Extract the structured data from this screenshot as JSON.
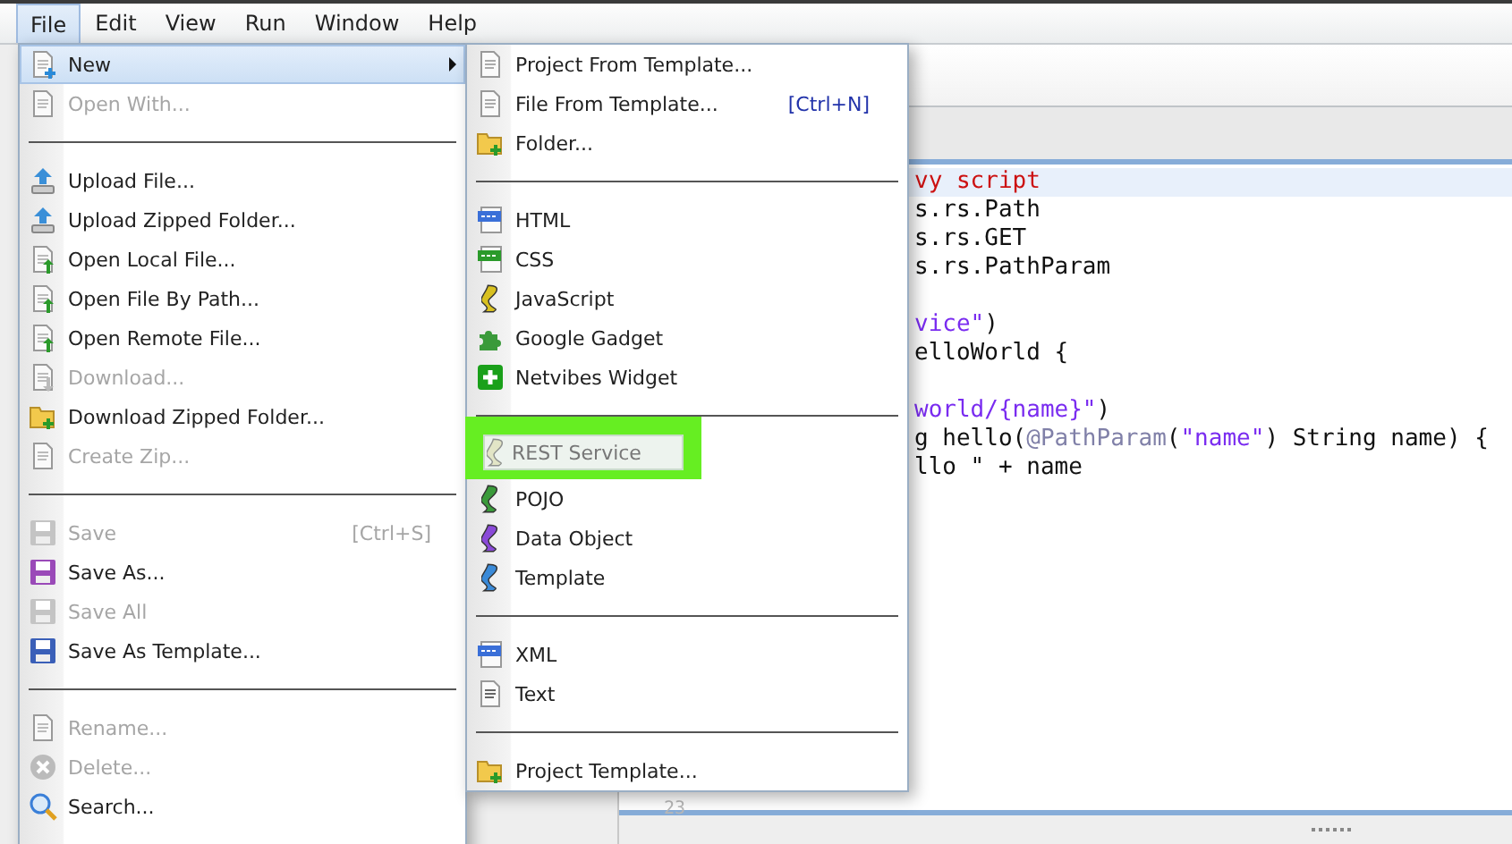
{
  "menubar": [
    {
      "label": "File",
      "selected": true
    },
    {
      "label": "Edit",
      "selected": false
    },
    {
      "label": "View",
      "selected": false
    },
    {
      "label": "Run",
      "selected": false
    },
    {
      "label": "Window",
      "selected": false
    },
    {
      "label": "Help",
      "selected": false
    }
  ],
  "file_menu": {
    "items": [
      {
        "kind": "item",
        "label": "New",
        "disabled": false,
        "selected": true,
        "submenu": true
      },
      {
        "kind": "item",
        "label": "Open With...",
        "disabled": true,
        "selected": false
      },
      {
        "kind": "separator"
      },
      {
        "kind": "item",
        "label": "Upload File...",
        "disabled": false,
        "selected": false
      },
      {
        "kind": "item",
        "label": "Upload Zipped Folder...",
        "disabled": false,
        "selected": false
      },
      {
        "kind": "item",
        "label": "Open Local File...",
        "disabled": false,
        "selected": false
      },
      {
        "kind": "item",
        "label": "Open File By Path...",
        "disabled": false,
        "selected": false
      },
      {
        "kind": "item",
        "label": "Open Remote File...",
        "disabled": false,
        "selected": false
      },
      {
        "kind": "item",
        "label": "Download...",
        "disabled": true,
        "selected": false
      },
      {
        "kind": "item",
        "label": "Download Zipped Folder...",
        "disabled": false,
        "selected": false
      },
      {
        "kind": "item",
        "label": "Create Zip...",
        "disabled": true,
        "selected": false
      },
      {
        "kind": "separator"
      },
      {
        "kind": "item",
        "label": "Save",
        "shortcut": "[Ctrl+S]",
        "disabled": true,
        "selected": false
      },
      {
        "kind": "item",
        "label": "Save As...",
        "disabled": false,
        "selected": false
      },
      {
        "kind": "item",
        "label": "Save All",
        "disabled": true,
        "selected": false
      },
      {
        "kind": "item",
        "label": "Save As Template...",
        "disabled": false,
        "selected": false
      },
      {
        "kind": "separator"
      },
      {
        "kind": "item",
        "label": "Rename...",
        "disabled": true,
        "selected": false
      },
      {
        "kind": "item",
        "label": "Delete...",
        "disabled": true,
        "selected": false
      },
      {
        "kind": "item",
        "label": "Search...",
        "disabled": false,
        "selected": false
      }
    ]
  },
  "new_submenu": {
    "items": [
      {
        "kind": "item",
        "label": "Project From Template...",
        "disabled": false,
        "highlighted": false
      },
      {
        "kind": "item",
        "label": "File From Template...",
        "shortcut": "[Ctrl+N]",
        "disabled": false,
        "highlighted": false
      },
      {
        "kind": "item",
        "label": "Folder...",
        "disabled": false,
        "highlighted": false
      },
      {
        "kind": "separator"
      },
      {
        "kind": "item",
        "label": "HTML",
        "disabled": false,
        "highlighted": false
      },
      {
        "kind": "item",
        "label": "CSS",
        "disabled": false,
        "highlighted": false
      },
      {
        "kind": "item",
        "label": "JavaScript",
        "disabled": false,
        "highlighted": false
      },
      {
        "kind": "item",
        "label": "Google Gadget",
        "disabled": false,
        "highlighted": false
      },
      {
        "kind": "item",
        "label": "Netvibes Widget",
        "disabled": false,
        "highlighted": false
      },
      {
        "kind": "separator"
      },
      {
        "kind": "item",
        "label": "REST Service",
        "disabled": false,
        "highlighted": true
      },
      {
        "kind": "item",
        "label": "POJO",
        "disabled": false,
        "highlighted": false
      },
      {
        "kind": "item",
        "label": "Data Object",
        "disabled": false,
        "highlighted": false
      },
      {
        "kind": "item",
        "label": "Template",
        "disabled": false,
        "highlighted": false
      },
      {
        "kind": "separator"
      },
      {
        "kind": "item",
        "label": "XML",
        "disabled": false,
        "highlighted": false
      },
      {
        "kind": "item",
        "label": "Text",
        "disabled": false,
        "highlighted": false
      },
      {
        "kind": "separator"
      },
      {
        "kind": "item",
        "label": "Project Template...",
        "disabled": false,
        "highlighted": false
      }
    ]
  },
  "editor": {
    "lines": [
      {
        "kind": "code",
        "current": true,
        "segments": [
          {
            "kind": "comment",
            "text": "vy script"
          }
        ]
      },
      {
        "kind": "code",
        "current": false,
        "segments": [
          {
            "kind": "plain",
            "text": "s.rs.Path"
          }
        ]
      },
      {
        "kind": "code",
        "current": false,
        "segments": [
          {
            "kind": "plain",
            "text": "s.rs.GET"
          }
        ]
      },
      {
        "kind": "code",
        "current": false,
        "segments": [
          {
            "kind": "plain",
            "text": "s.rs.PathParam"
          }
        ]
      },
      {
        "kind": "blank",
        "current": false
      },
      {
        "kind": "code",
        "current": false,
        "segments": [
          {
            "kind": "string",
            "text": "vice\""
          },
          {
            "kind": "plain",
            "text": ")"
          }
        ]
      },
      {
        "kind": "code",
        "current": false,
        "segments": [
          {
            "kind": "plain",
            "text": "elloWorld {"
          }
        ]
      },
      {
        "kind": "blank",
        "current": false
      },
      {
        "kind": "code",
        "current": false,
        "segments": [
          {
            "kind": "string",
            "text": "world/{name}\""
          },
          {
            "kind": "plain",
            "text": ")"
          }
        ]
      },
      {
        "kind": "code",
        "current": false,
        "segments": [
          {
            "kind": "plain",
            "text": "g hello("
          },
          {
            "kind": "annotation",
            "text": "@PathParam"
          },
          {
            "kind": "plain",
            "text": "("
          },
          {
            "kind": "string",
            "text": "\"name\""
          },
          {
            "kind": "plain",
            "text": ") String name) {"
          }
        ]
      },
      {
        "kind": "code",
        "current": false,
        "segments": [
          {
            "kind": "plain",
            "text": "llo \" + name"
          }
        ]
      }
    ],
    "line_number": "23"
  }
}
